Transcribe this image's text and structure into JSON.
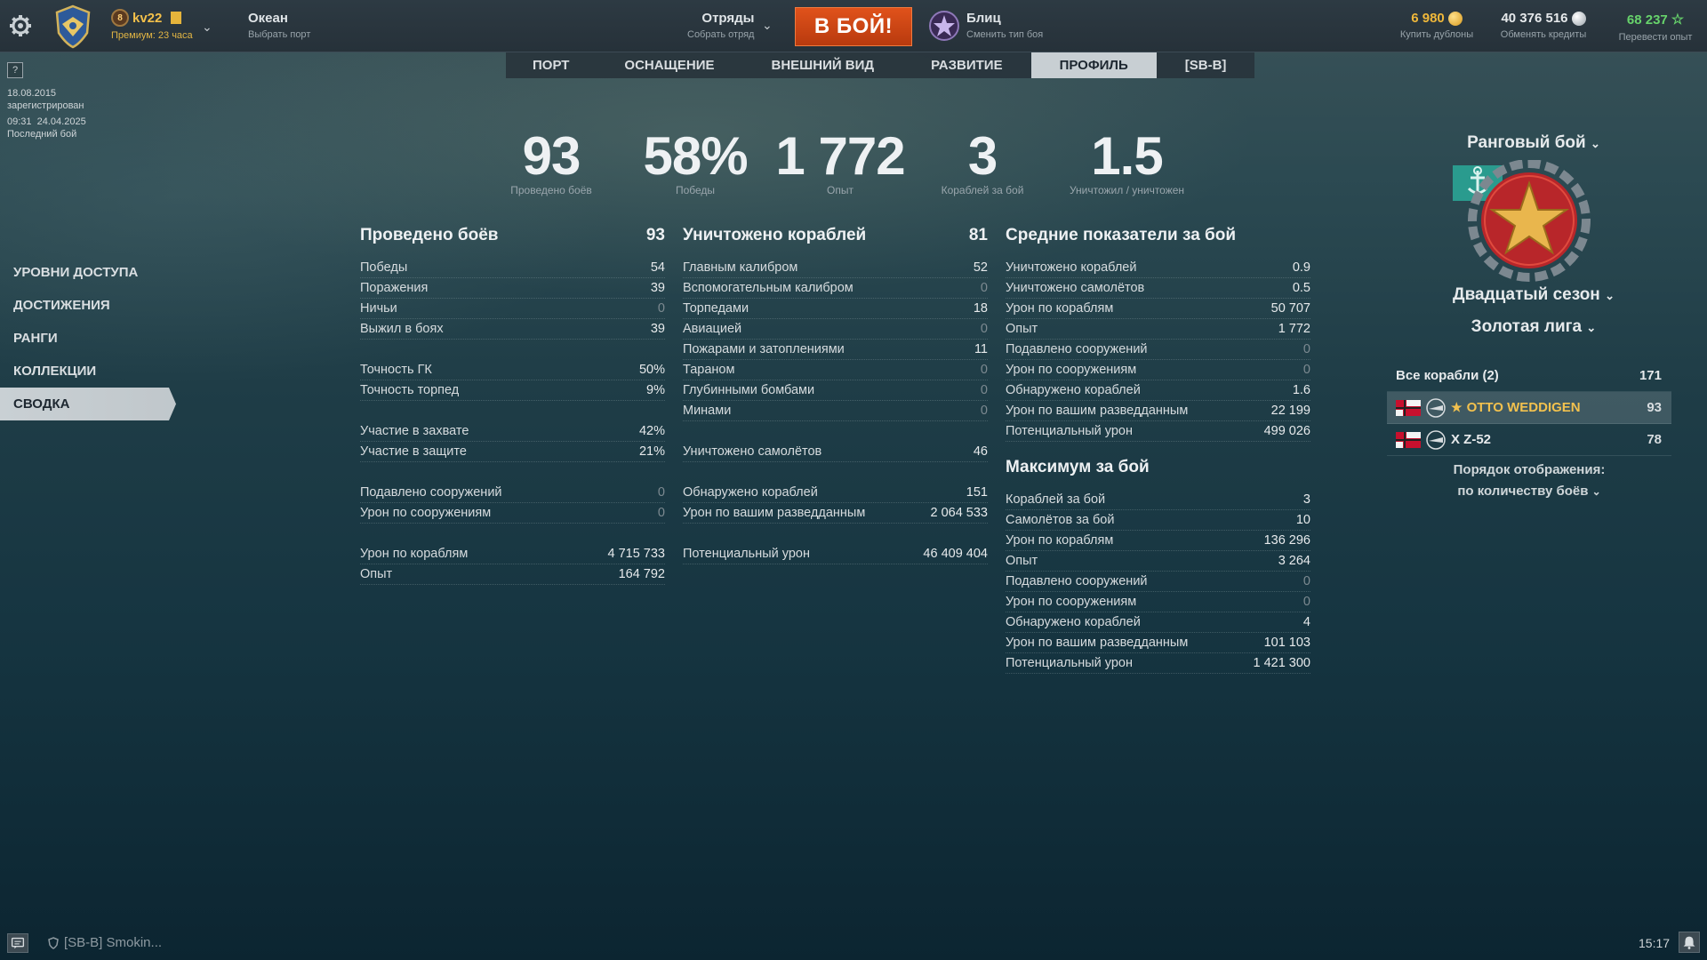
{
  "topbar": {
    "user": {
      "name": "kv22",
      "rank_badge": "8",
      "premium": "Премиум: 23 часа"
    },
    "port": {
      "title": "Океан",
      "subtitle": "Выбрать порт"
    },
    "squad": {
      "title": "Отряды",
      "subtitle": "Собрать отряд"
    },
    "battle_button": "В БОЙ!",
    "mode": {
      "title": "Блиц",
      "subtitle": "Сменить тип боя"
    },
    "doubloons": {
      "value": "6 980",
      "label": "Купить дублоны"
    },
    "credits": {
      "value": "40 376 516",
      "label": "Обменять кредиты"
    },
    "free_xp": {
      "value": "68 237",
      "label": "Перевести опыт"
    }
  },
  "tabs": [
    "ПОРТ",
    "ОСНАЩЕНИЕ",
    "ВНЕШНИЙ ВИД",
    "РАЗВИТИЕ",
    "ПРОФИЛЬ",
    "[SB-B]"
  ],
  "active_tab": "ПРОФИЛЬ",
  "left_info": {
    "help": "?",
    "reg_date": "18.08.2015",
    "reg_label": "зарегистрирован",
    "last_battle": "09:31  24.04.2025",
    "last_label": "Последний бой"
  },
  "side_menu": [
    "УРОВНИ ДОСТУПА",
    "ДОСТИЖЕНИЯ",
    "РАНГИ",
    "КОЛЛЕКЦИИ",
    "СВОДКА"
  ],
  "summary": [
    {
      "value": "93",
      "label": "Проведено боёв"
    },
    {
      "value": "58%",
      "label": "Победы"
    },
    {
      "value": "1 772",
      "label": "Опыт"
    },
    {
      "value": "3",
      "label": "Кораблей за бой"
    },
    {
      "value": "1.5",
      "label": "Уничтожил / уничтожен"
    }
  ],
  "col1": {
    "title": "Проведено боёв",
    "total": "93",
    "groups": [
      [
        [
          "Победы",
          "54"
        ],
        [
          "Поражения",
          "39"
        ],
        [
          "Ничьи",
          "0"
        ],
        [
          "Выжил в боях",
          "39"
        ]
      ],
      [
        [
          "Точность ГК",
          "50%"
        ],
        [
          "Точность торпед",
          "9%"
        ]
      ],
      [
        [
          "Участие в захвате",
          "42%"
        ],
        [
          "Участие в защите",
          "21%"
        ]
      ],
      [
        [
          "Подавлено сооружений",
          "0"
        ],
        [
          "Урон по сооружениям",
          "0"
        ]
      ],
      [
        [
          "Урон по кораблям",
          "4 715 733"
        ],
        [
          "Опыт",
          "164 792"
        ]
      ]
    ]
  },
  "col2": {
    "title": "Уничтожено кораблей",
    "total": "81",
    "groups": [
      [
        [
          "Главным калибром",
          "52"
        ],
        [
          "Вспомогательным калибром",
          "0"
        ],
        [
          "Торпедами",
          "18"
        ],
        [
          "Авиацией",
          "0"
        ],
        [
          "Пожарами и затоплениями",
          "11"
        ],
        [
          "Тараном",
          "0"
        ],
        [
          "Глубинными бомбами",
          "0"
        ],
        [
          "Минами",
          "0"
        ]
      ],
      [
        [
          "Уничтожено самолётов",
          "46"
        ]
      ],
      [
        [
          "Обнаружено кораблей",
          "151"
        ],
        [
          "Урон по вашим разведданным",
          "2 064 533"
        ]
      ],
      [
        [
          "Потенциальный урон",
          "46 409 404"
        ]
      ]
    ]
  },
  "col3": {
    "title": "Средние показатели за бой",
    "rows": [
      [
        "Уничтожено кораблей",
        "0.9"
      ],
      [
        "Уничтожено самолётов",
        "0.5"
      ],
      [
        "Урон по кораблям",
        "50 707"
      ],
      [
        "Опыт",
        "1 772"
      ],
      [
        "Подавлено сооружений",
        "0"
      ],
      [
        "Урон по сооружениям",
        "0"
      ],
      [
        "Обнаружено кораблей",
        "1.6"
      ],
      [
        "Урон по вашим разведданным",
        "22 199"
      ],
      [
        "Потенциальный урон",
        "499 026"
      ]
    ],
    "max_title": "Максимум за бой",
    "max_rows": [
      [
        "Кораблей за бой",
        "3"
      ],
      [
        "Самолётов за бой",
        "10"
      ],
      [
        "Урон по кораблям",
        "136 296"
      ],
      [
        "Опыт",
        "3 264"
      ],
      [
        "Подавлено сооружений",
        "0"
      ],
      [
        "Урон по сооружениям",
        "0"
      ],
      [
        "Обнаружено кораблей",
        "4"
      ],
      [
        "Урон по вашим разведданным",
        "101 103"
      ],
      [
        "Потенциальный урон",
        "1 421 300"
      ]
    ]
  },
  "right": {
    "mode_title": "Ранговый бой",
    "season_title": "Двадцатый сезон",
    "league_title": "Золотая лига",
    "all_ships_label": "Все корабли (2)",
    "all_ships_count": "171",
    "ships": [
      {
        "name": "OTTO WEDDIGEN",
        "count": "93",
        "tier": "★",
        "selected": true
      },
      {
        "name": "X Z-52",
        "count": "78",
        "tier": "",
        "selected": false
      }
    ],
    "sort_label": "Порядок отображения:",
    "sort_value": "по количеству боёв"
  },
  "bottom": {
    "chat_text": "[SB-B] Smokin...",
    "clock": "15:17"
  },
  "colors": {
    "accent_gold": "#f2c14e",
    "battle_orange": "#d2471a",
    "xp_green": "#67d36b"
  }
}
